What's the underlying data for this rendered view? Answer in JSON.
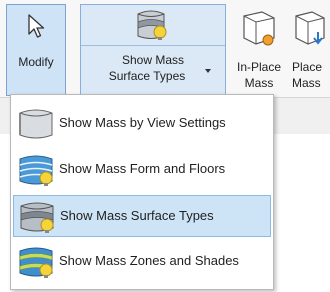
{
  "ribbon": {
    "modify": {
      "label": "Modify",
      "icon": "cursor-arrow-icon"
    },
    "show_mass": {
      "label_line1": "Show Mass",
      "label_line2": "Surface Types",
      "icon": "mass-surface-types-icon"
    },
    "in_place_mass": {
      "label_line1": "In-Place",
      "label_line2": "Mass",
      "icon": "in-place-mass-icon"
    },
    "place_mass": {
      "label_line1": "Place",
      "label_line2": "Mass",
      "icon": "place-mass-icon"
    }
  },
  "menu": {
    "items": [
      {
        "label": "Show Mass  by View Settings",
        "icon": "mass-view-settings-icon",
        "selected": false
      },
      {
        "label": "Show Mass  Form and Floors",
        "icon": "mass-form-floors-icon",
        "selected": false
      },
      {
        "label": "Show Mass  Surface Types",
        "icon": "mass-surface-types-icon",
        "selected": true
      },
      {
        "label": "Show Mass  Zones and Shades",
        "icon": "mass-zones-shades-icon",
        "selected": false
      }
    ]
  },
  "colors": {
    "selected_bg": "#cde4f7",
    "selected_border": "#8fb8e3",
    "bulb": "#f5d33a"
  }
}
